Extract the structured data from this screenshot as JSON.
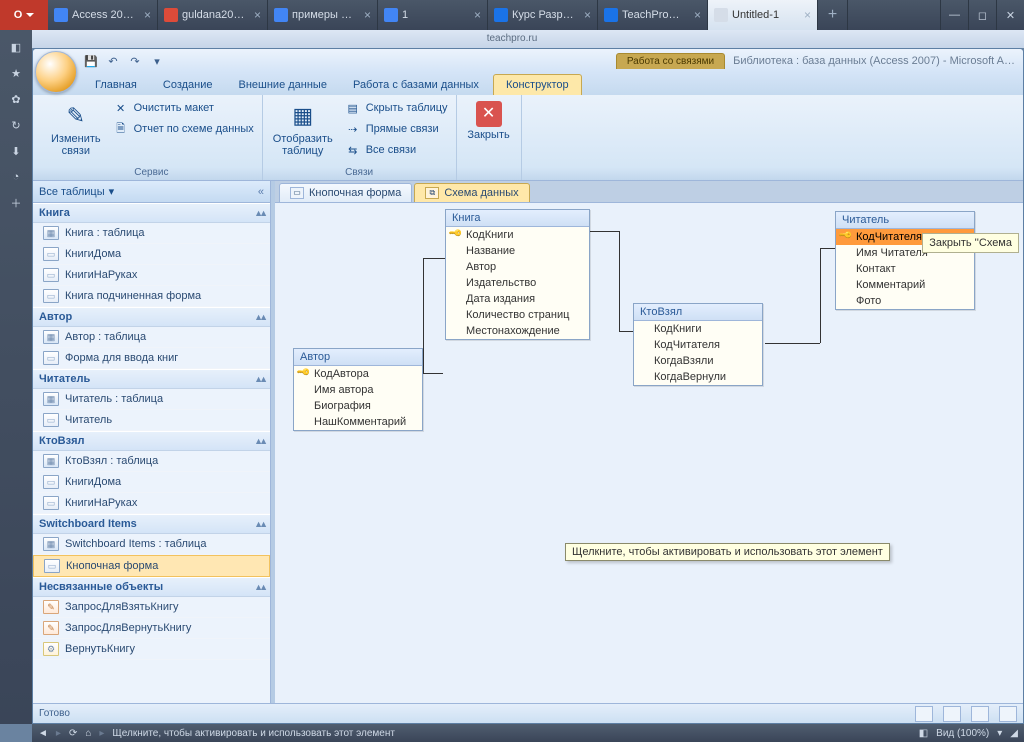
{
  "browser": {
    "tabs": [
      {
        "label": "Access 20…",
        "fav": "#4285f4"
      },
      {
        "label": "guldana20…",
        "fav": "#dd4b39"
      },
      {
        "label": "примеры …",
        "fav": "#4285f4"
      },
      {
        "label": "1",
        "fav": "#4285f4"
      },
      {
        "label": "Курс Разр…",
        "fav": "#1a73e8"
      },
      {
        "label": "TeachPro…",
        "fav": "#1a73e8"
      },
      {
        "label": "Untitled-1",
        "fav": "#d5dde8"
      }
    ],
    "address": "teachpro.ru"
  },
  "app": {
    "context_tab": "Работа со связями",
    "title": "Библиотека : база данных (Access 2007) - Microsoft A…",
    "tabs": {
      "home": "Главная",
      "create": "Создание",
      "external": "Внешние данные",
      "dbtools": "Работа с базами данных",
      "designer": "Конструктор"
    },
    "ribbon": {
      "service_group": "Сервис",
      "relations_group": "Связи",
      "edit_relations": "Изменить\nсвязи",
      "clear_layout": "Очистить макет",
      "relation_report": "Отчет по схеме данных",
      "show_table": "Отобразить\nтаблицу",
      "hide_table": "Скрыть таблицу",
      "direct_links": "Прямые связи",
      "all_links": "Все связи",
      "close": "Закрыть"
    }
  },
  "nav": {
    "header": "Все таблицы",
    "groups": [
      {
        "title": "Книга",
        "items": [
          {
            "t": "table",
            "label": "Книга : таблица"
          },
          {
            "t": "form",
            "label": "КнигиДома"
          },
          {
            "t": "form",
            "label": "КнигиНаРуках"
          },
          {
            "t": "form",
            "label": "Книга подчиненная форма"
          }
        ]
      },
      {
        "title": "Автор",
        "items": [
          {
            "t": "table",
            "label": "Автор : таблица"
          },
          {
            "t": "form",
            "label": "Форма для ввода книг"
          }
        ]
      },
      {
        "title": "Читатель",
        "items": [
          {
            "t": "table",
            "label": "Читатель : таблица"
          },
          {
            "t": "form",
            "label": "Читатель"
          }
        ]
      },
      {
        "title": "КтоВзял",
        "items": [
          {
            "t": "table",
            "label": "КтоВзял : таблица"
          },
          {
            "t": "form",
            "label": "КнигиДома"
          },
          {
            "t": "form",
            "label": "КнигиНаРуках"
          }
        ]
      },
      {
        "title": "Switchboard Items",
        "items": [
          {
            "t": "table",
            "label": "Switchboard Items : таблица"
          },
          {
            "t": "form",
            "label": "Кнопочная форма",
            "selected": true
          }
        ]
      },
      {
        "title": "Несвязанные объекты",
        "items": [
          {
            "t": "query",
            "label": "ЗапросДляВзятьКнигу"
          },
          {
            "t": "query",
            "label": "ЗапросДляВернутьКнигу"
          },
          {
            "t": "macro",
            "label": "ВернутьКнигу"
          }
        ]
      }
    ]
  },
  "doc_tabs": {
    "form": "Кнопочная форма",
    "schema": "Схема данных"
  },
  "schema": {
    "kniga": {
      "title": "Книга",
      "fields": [
        "КодКниги",
        "Название",
        "Автор",
        "Издательство",
        "Дата издания",
        "Количество страниц",
        "Местонахождение"
      ],
      "keys": [
        0
      ]
    },
    "avtor": {
      "title": "Автор",
      "fields": [
        "КодАвтора",
        "Имя автора",
        "Биография",
        "НашКомментарий"
      ],
      "keys": [
        0
      ]
    },
    "ktovzyal": {
      "title": "КтоВзял",
      "fields": [
        "КодКниги",
        "КодЧитателя",
        "КогдаВзяли",
        "КогдаВернули"
      ]
    },
    "chitatel": {
      "title": "Читатель",
      "fields": [
        "КодЧитателя",
        "Имя Читателя",
        "Контакт",
        "Комментарий",
        "Фото"
      ],
      "keys": [
        0
      ],
      "selected": 0
    }
  },
  "tooltips": {
    "close": "Закрыть ''Схема",
    "activate": "Щелкните, чтобы активировать и использовать этот элемент"
  },
  "status": {
    "ready": "Готово",
    "view_text": "Вид (100%)",
    "zoom": "100%"
  },
  "taskbar": {
    "hint": "Щелкните, чтобы активировать и использовать этот элемент"
  }
}
